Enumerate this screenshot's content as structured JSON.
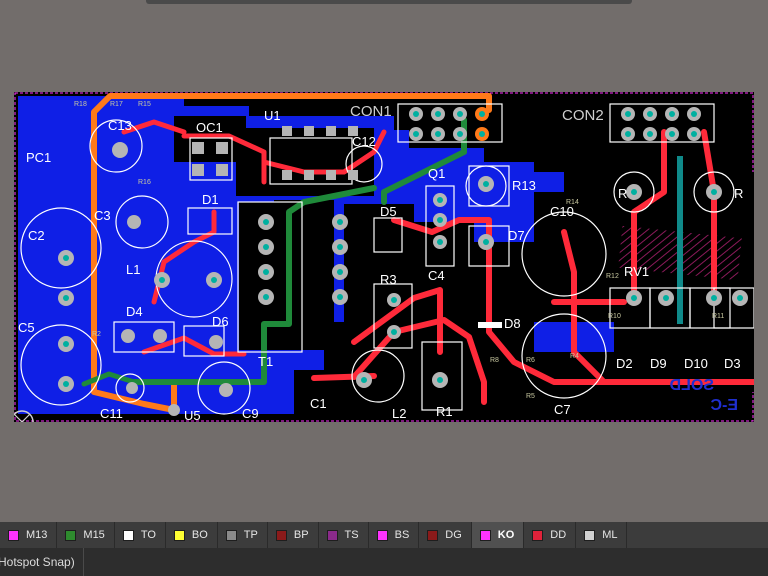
{
  "board": {
    "designators": {
      "con1": "CON1",
      "con2": "CON2",
      "pc1": "PC1",
      "c13": "C13",
      "oc1": "OC1",
      "u1": "U1",
      "c12": "C12",
      "q1": "Q1",
      "r13": "R13",
      "c10": "C10",
      "rv1": "RV1",
      "r_left": "R",
      "r_right": "R",
      "c2": "C2",
      "c3": "C3",
      "d1": "D1",
      "l1": "L1",
      "d5": "D5",
      "d7": "D7",
      "c5": "C5",
      "d4": "D4",
      "d6": "D6",
      "r3": "R3",
      "c4": "C4",
      "d8": "D8",
      "t1": "T1",
      "c1": "C1",
      "l2": "L2",
      "r1": "R1",
      "c7": "C7",
      "c11": "C11",
      "u5": "U5",
      "c9": "C9",
      "d2": "D2",
      "d9": "D9",
      "d10": "D10",
      "d3": "D3"
    },
    "silk_small": {
      "r18": "R18",
      "r17": "R17",
      "r15": "R15",
      "r16": "R16",
      "r14": "R14",
      "r12": "R12",
      "r10": "R10",
      "r11": "R11",
      "r2": "R2",
      "r4": "R4",
      "r6": "R6",
      "r5": "R5",
      "r8": "R8"
    },
    "bottom_text": {
      "line1": "SOLD",
      "line2": "E-C"
    }
  },
  "layers": [
    {
      "name": "M13",
      "color": "#ff33ff"
    },
    {
      "name": "M15",
      "color": "#2e8b2e"
    },
    {
      "name": "TO",
      "color": "#ffffff"
    },
    {
      "name": "BO",
      "color": "#ffff33"
    },
    {
      "name": "TP",
      "color": "#8a8a8a"
    },
    {
      "name": "BP",
      "color": "#8b1a1a"
    },
    {
      "name": "TS",
      "color": "#8b2a8b"
    },
    {
      "name": "BS",
      "color": "#ff33ff"
    },
    {
      "name": "DG",
      "color": "#8b1a1a"
    },
    {
      "name": "KO",
      "color": "#ff33ff"
    },
    {
      "name": "DD",
      "color": "#e0223a"
    },
    {
      "name": "ML",
      "color": "#d0d0d0"
    }
  ],
  "active_layer": "KO",
  "status": {
    "snap_text": "(Hotspot Snap)"
  }
}
